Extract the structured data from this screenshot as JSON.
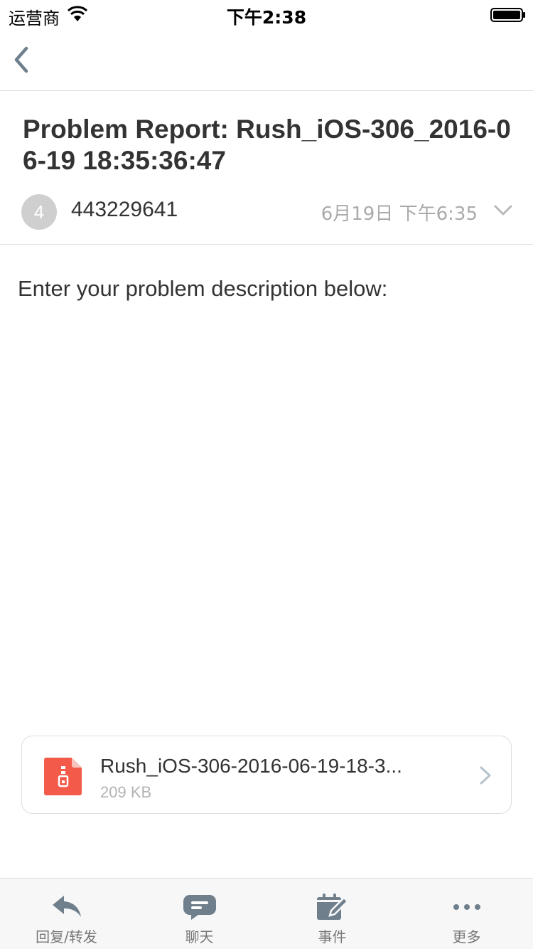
{
  "status_bar": {
    "carrier": "运营商",
    "time": "下午2:38"
  },
  "nav": {
    "back_icon": "chevron-left-icon"
  },
  "mail": {
    "subject": "Problem Report: Rush_iOS-306_2016-06-19 18:35:36:47",
    "sender_avatar_initial": "4",
    "sender": "443229641",
    "date": "6月19日 下午6:35",
    "body": "Enter your problem description below:"
  },
  "attachment": {
    "name": "Rush_iOS-306-2016-06-19-18-3...",
    "size": "209 KB",
    "icon": "zip-file-icon",
    "icon_color": "#f35a4a"
  },
  "toolbar": {
    "items": [
      {
        "label": "回复/转发",
        "icon": "reply-icon"
      },
      {
        "label": "聊天",
        "icon": "chat-bubble-icon"
      },
      {
        "label": "事件",
        "icon": "calendar-edit-icon"
      },
      {
        "label": "更多",
        "icon": "more-dots-icon"
      }
    ]
  },
  "colors": {
    "icon_gray": "#6f7f8c",
    "text_primary": "#333333",
    "text_secondary": "#aaaaaa"
  }
}
